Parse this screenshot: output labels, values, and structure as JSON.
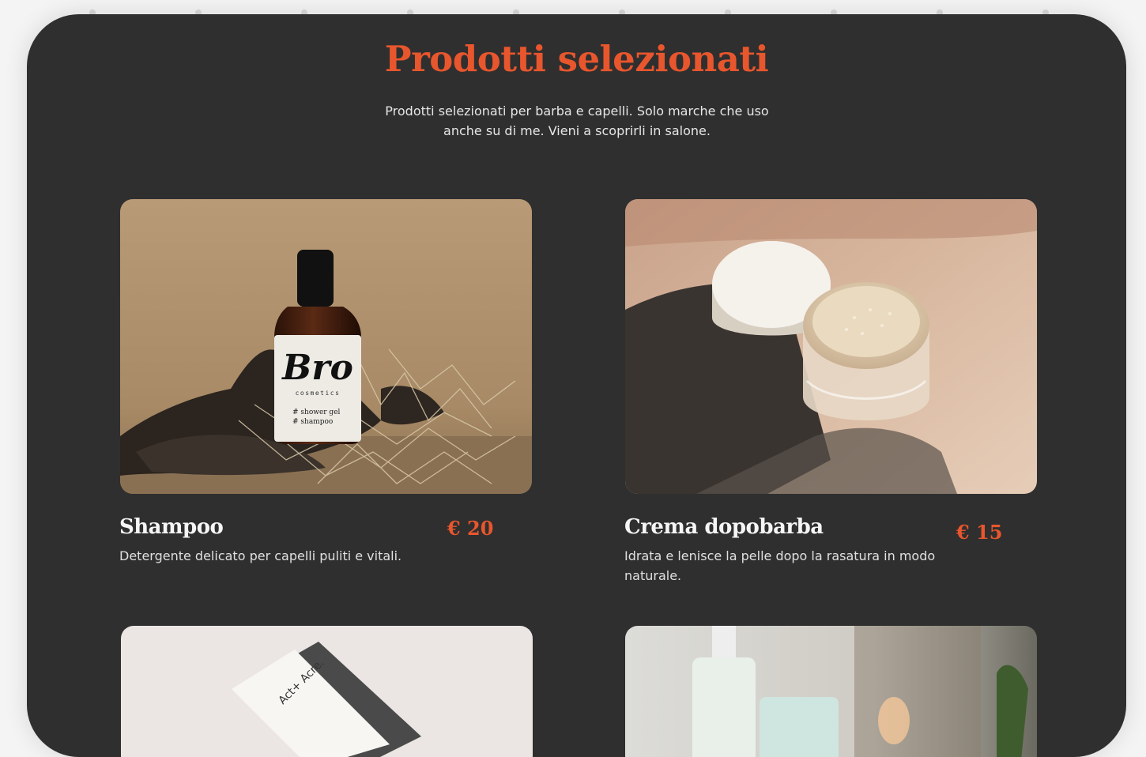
{
  "section": {
    "title": "Prodotti selezionati",
    "subtitle": "Prodotti selezionati per barba e capelli. Solo marche che uso anche su di me. Vieni a scoprirli in salone."
  },
  "products": [
    {
      "name": "Shampoo",
      "price": "€ 20",
      "description": "Detergente delicato per capelli puliti e vitali.",
      "bottle_brand": "Bro",
      "bottle_sub": "cosmetics",
      "bottle_tags": [
        "# shower gel",
        "# shampoo"
      ]
    },
    {
      "name": "Crema dopobarba",
      "price": "€ 15",
      "description": "Idrata e lenisce la pelle dopo la rasatura in modo naturale."
    },
    {
      "name": "",
      "price": "",
      "description": "",
      "box_brand": "Act+ Acre."
    },
    {
      "name": "",
      "price": "",
      "description": ""
    }
  ],
  "colors": {
    "accent": "#e8562d",
    "panel": "#2f2f2f",
    "text": "#f5f5f5"
  }
}
